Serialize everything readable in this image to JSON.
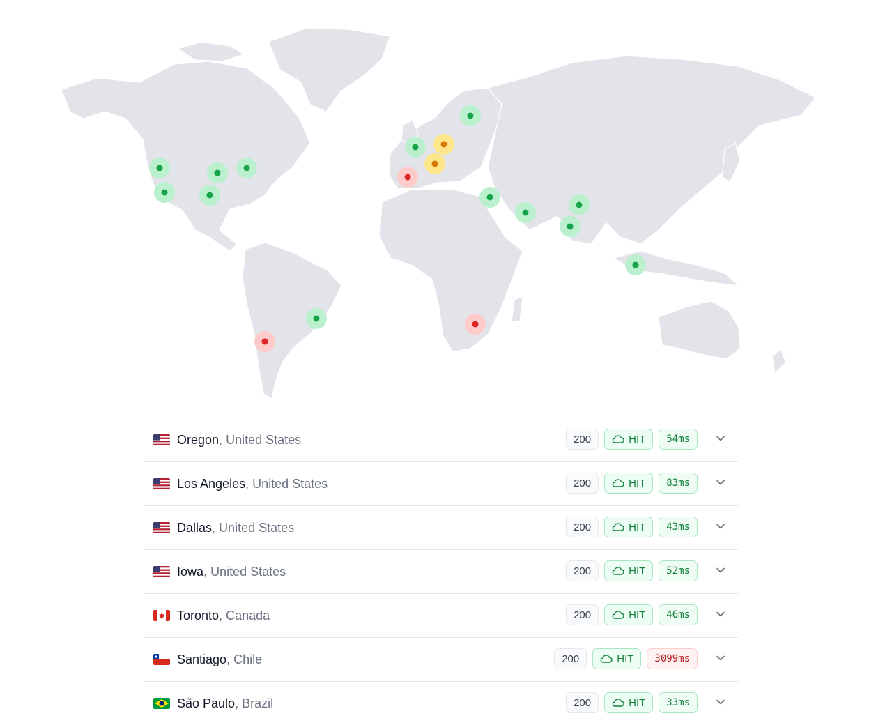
{
  "map": {
    "marker_colors": {
      "ok": "#16a34a",
      "ok_halo": "#bbf0cf",
      "warn": "#d97706",
      "warn_halo": "#fde68a",
      "error": "#dc2626",
      "error_halo": "#fecaca"
    },
    "markers": [
      {
        "name": "oregon",
        "status": "ok"
      },
      {
        "name": "los-angeles",
        "status": "ok"
      },
      {
        "name": "iowa",
        "status": "ok"
      },
      {
        "name": "toronto",
        "status": "ok"
      },
      {
        "name": "dallas",
        "status": "ok"
      },
      {
        "name": "london",
        "status": "ok"
      },
      {
        "name": "frankfurt",
        "status": "warn"
      },
      {
        "name": "paris-zurich",
        "status": "warn"
      },
      {
        "name": "madrid",
        "status": "error"
      },
      {
        "name": "stockholm",
        "status": "ok"
      },
      {
        "name": "tel-aviv",
        "status": "ok"
      },
      {
        "name": "dubai",
        "status": "ok"
      },
      {
        "name": "delhi",
        "status": "ok"
      },
      {
        "name": "mumbai",
        "status": "ok"
      },
      {
        "name": "singapore",
        "status": "ok"
      },
      {
        "name": "sao-paulo",
        "status": "ok"
      },
      {
        "name": "santiago",
        "status": "error"
      },
      {
        "name": "johannesburg",
        "status": "error"
      }
    ]
  },
  "results": [
    {
      "city": "Oregon",
      "country": "United States",
      "flag": "us-flag",
      "status": "200",
      "cache": "HIT",
      "time": "54ms",
      "slow": false
    },
    {
      "city": "Los Angeles",
      "country": "United States",
      "flag": "us-flag",
      "status": "200",
      "cache": "HIT",
      "time": "83ms",
      "slow": false
    },
    {
      "city": "Dallas",
      "country": "United States",
      "flag": "us-flag",
      "status": "200",
      "cache": "HIT",
      "time": "43ms",
      "slow": false
    },
    {
      "city": "Iowa",
      "country": "United States",
      "flag": "us-flag",
      "status": "200",
      "cache": "HIT",
      "time": "52ms",
      "slow": false
    },
    {
      "city": "Toronto",
      "country": "Canada",
      "flag": "canada-flag",
      "status": "200",
      "cache": "HIT",
      "time": "46ms",
      "slow": false
    },
    {
      "city": "Santiago",
      "country": "Chile",
      "flag": "chile-flag",
      "status": "200",
      "cache": "HIT",
      "time": "3099ms",
      "slow": true
    },
    {
      "city": "São Paulo",
      "country": "Brazil",
      "flag": "brazil-flag",
      "status": "200",
      "cache": "HIT",
      "time": "33ms",
      "slow": false
    }
  ],
  "separator": ","
}
